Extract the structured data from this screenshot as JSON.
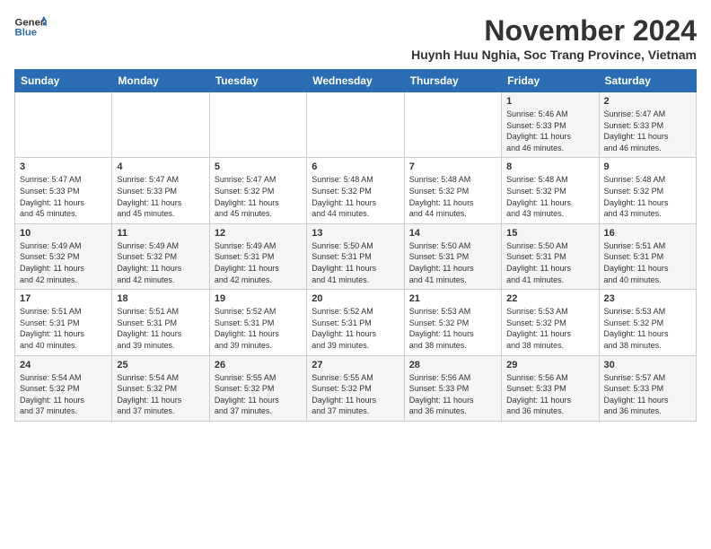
{
  "logo": {
    "general": "General",
    "blue": "Blue"
  },
  "header": {
    "month": "November 2024",
    "location": "Huynh Huu Nghia, Soc Trang Province, Vietnam"
  },
  "weekdays": [
    "Sunday",
    "Monday",
    "Tuesday",
    "Wednesday",
    "Thursday",
    "Friday",
    "Saturday"
  ],
  "weeks": [
    [
      {
        "day": "",
        "content": ""
      },
      {
        "day": "",
        "content": ""
      },
      {
        "day": "",
        "content": ""
      },
      {
        "day": "",
        "content": ""
      },
      {
        "day": "",
        "content": ""
      },
      {
        "day": "1",
        "content": "Sunrise: 5:46 AM\nSunset: 5:33 PM\nDaylight: 11 hours\nand 46 minutes."
      },
      {
        "day": "2",
        "content": "Sunrise: 5:47 AM\nSunset: 5:33 PM\nDaylight: 11 hours\nand 46 minutes."
      }
    ],
    [
      {
        "day": "3",
        "content": "Sunrise: 5:47 AM\nSunset: 5:33 PM\nDaylight: 11 hours\nand 45 minutes."
      },
      {
        "day": "4",
        "content": "Sunrise: 5:47 AM\nSunset: 5:33 PM\nDaylight: 11 hours\nand 45 minutes."
      },
      {
        "day": "5",
        "content": "Sunrise: 5:47 AM\nSunset: 5:32 PM\nDaylight: 11 hours\nand 45 minutes."
      },
      {
        "day": "6",
        "content": "Sunrise: 5:48 AM\nSunset: 5:32 PM\nDaylight: 11 hours\nand 44 minutes."
      },
      {
        "day": "7",
        "content": "Sunrise: 5:48 AM\nSunset: 5:32 PM\nDaylight: 11 hours\nand 44 minutes."
      },
      {
        "day": "8",
        "content": "Sunrise: 5:48 AM\nSunset: 5:32 PM\nDaylight: 11 hours\nand 43 minutes."
      },
      {
        "day": "9",
        "content": "Sunrise: 5:48 AM\nSunset: 5:32 PM\nDaylight: 11 hours\nand 43 minutes."
      }
    ],
    [
      {
        "day": "10",
        "content": "Sunrise: 5:49 AM\nSunset: 5:32 PM\nDaylight: 11 hours\nand 42 minutes."
      },
      {
        "day": "11",
        "content": "Sunrise: 5:49 AM\nSunset: 5:32 PM\nDaylight: 11 hours\nand 42 minutes."
      },
      {
        "day": "12",
        "content": "Sunrise: 5:49 AM\nSunset: 5:31 PM\nDaylight: 11 hours\nand 42 minutes."
      },
      {
        "day": "13",
        "content": "Sunrise: 5:50 AM\nSunset: 5:31 PM\nDaylight: 11 hours\nand 41 minutes."
      },
      {
        "day": "14",
        "content": "Sunrise: 5:50 AM\nSunset: 5:31 PM\nDaylight: 11 hours\nand 41 minutes."
      },
      {
        "day": "15",
        "content": "Sunrise: 5:50 AM\nSunset: 5:31 PM\nDaylight: 11 hours\nand 41 minutes."
      },
      {
        "day": "16",
        "content": "Sunrise: 5:51 AM\nSunset: 5:31 PM\nDaylight: 11 hours\nand 40 minutes."
      }
    ],
    [
      {
        "day": "17",
        "content": "Sunrise: 5:51 AM\nSunset: 5:31 PM\nDaylight: 11 hours\nand 40 minutes."
      },
      {
        "day": "18",
        "content": "Sunrise: 5:51 AM\nSunset: 5:31 PM\nDaylight: 11 hours\nand 39 minutes."
      },
      {
        "day": "19",
        "content": "Sunrise: 5:52 AM\nSunset: 5:31 PM\nDaylight: 11 hours\nand 39 minutes."
      },
      {
        "day": "20",
        "content": "Sunrise: 5:52 AM\nSunset: 5:31 PM\nDaylight: 11 hours\nand 39 minutes."
      },
      {
        "day": "21",
        "content": "Sunrise: 5:53 AM\nSunset: 5:32 PM\nDaylight: 11 hours\nand 38 minutes."
      },
      {
        "day": "22",
        "content": "Sunrise: 5:53 AM\nSunset: 5:32 PM\nDaylight: 11 hours\nand 38 minutes."
      },
      {
        "day": "23",
        "content": "Sunrise: 5:53 AM\nSunset: 5:32 PM\nDaylight: 11 hours\nand 38 minutes."
      }
    ],
    [
      {
        "day": "24",
        "content": "Sunrise: 5:54 AM\nSunset: 5:32 PM\nDaylight: 11 hours\nand 37 minutes."
      },
      {
        "day": "25",
        "content": "Sunrise: 5:54 AM\nSunset: 5:32 PM\nDaylight: 11 hours\nand 37 minutes."
      },
      {
        "day": "26",
        "content": "Sunrise: 5:55 AM\nSunset: 5:32 PM\nDaylight: 11 hours\nand 37 minutes."
      },
      {
        "day": "27",
        "content": "Sunrise: 5:55 AM\nSunset: 5:32 PM\nDaylight: 11 hours\nand 37 minutes."
      },
      {
        "day": "28",
        "content": "Sunrise: 5:56 AM\nSunset: 5:33 PM\nDaylight: 11 hours\nand 36 minutes."
      },
      {
        "day": "29",
        "content": "Sunrise: 5:56 AM\nSunset: 5:33 PM\nDaylight: 11 hours\nand 36 minutes."
      },
      {
        "day": "30",
        "content": "Sunrise: 5:57 AM\nSunset: 5:33 PM\nDaylight: 11 hours\nand 36 minutes."
      }
    ]
  ]
}
